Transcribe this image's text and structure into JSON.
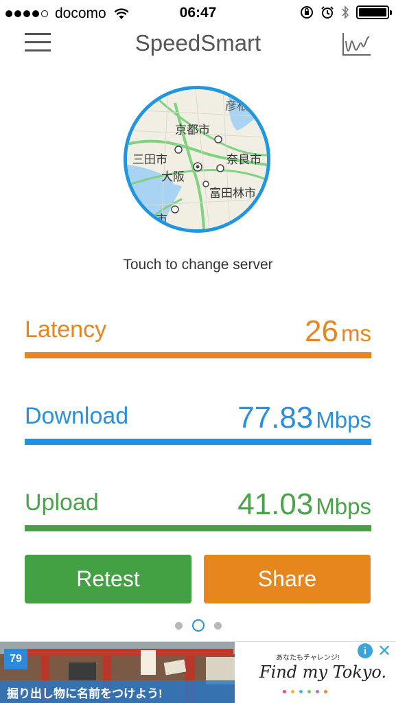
{
  "status_bar": {
    "carrier": "docomo",
    "time": "06:47",
    "signal_bars_filled": 4,
    "signal_bars_total": 5
  },
  "header": {
    "title": "SpeedSmart",
    "menu_icon": "hamburger-menu-icon",
    "graph_icon": "line-graph-icon"
  },
  "server_map": {
    "labels": [
      "彦根",
      "京都市",
      "三田市",
      "大阪",
      "奈良市",
      "富田林市",
      "市"
    ],
    "hint": "Touch to change server"
  },
  "metrics": {
    "latency": {
      "label": "Latency",
      "value": "26",
      "unit": "ms"
    },
    "download": {
      "label": "Download",
      "value": "77.83",
      "unit": "Mbps"
    },
    "upload": {
      "label": "Upload",
      "value": "41.03",
      "unit": "Mbps"
    }
  },
  "actions": {
    "retest": "Retest",
    "share": "Share"
  },
  "pager": {
    "pages": 3,
    "active_index": 1
  },
  "ad": {
    "badge": "79",
    "caption": "掘り出し物に名前をつけよう!",
    "sub": "あなたもチャレンジ!",
    "brand": "Find my Tokyo.",
    "info_icon": "info-icon",
    "close_icon": "close-icon"
  },
  "colors": {
    "latency": "#e8861e",
    "download": "#2190e0",
    "upload": "#47a047",
    "retest_button": "#43a043",
    "share_button": "#e8861e"
  }
}
